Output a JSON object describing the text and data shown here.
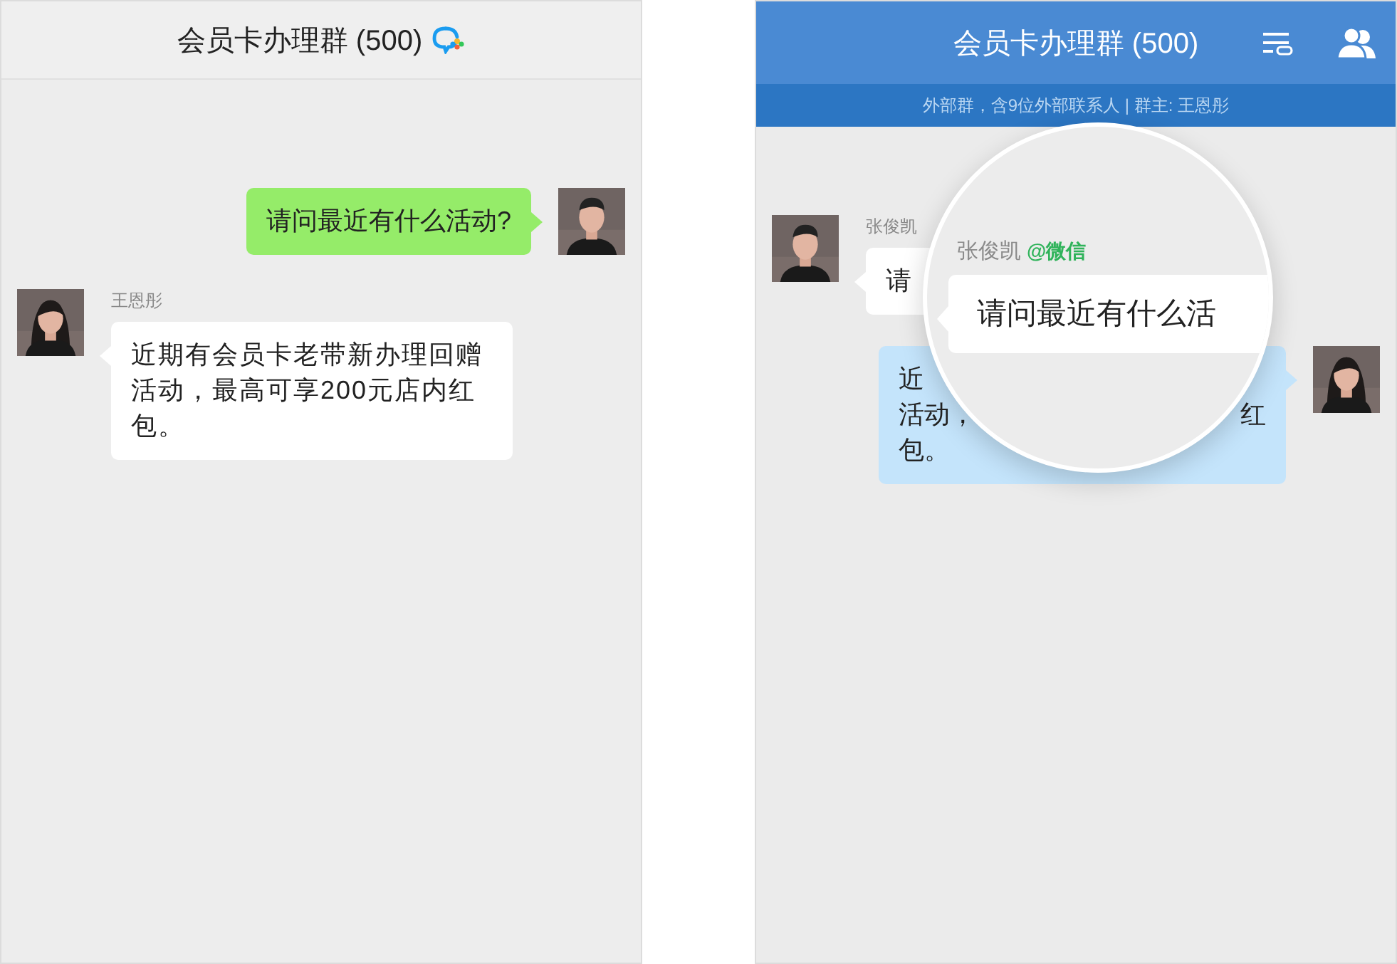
{
  "left_chat": {
    "title": "会员卡办理群 (500)",
    "messages": [
      {
        "kind": "outgoing",
        "text": "请问最近有什么活动?"
      },
      {
        "kind": "incoming",
        "sender": "王恩彤",
        "text": "近期有会员卡老带新办理回赠活动，最高可享200元店内红包。"
      }
    ]
  },
  "right_chat": {
    "title": "会员卡办理群 (500)",
    "subtitle": "外部群，含9位外部联系人 | 群主: 王恩彤",
    "messages": [
      {
        "kind": "incoming",
        "sender": "张俊凯",
        "lines": [
          [
            "请"
          ]
        ]
      },
      {
        "kind": "outgoing",
        "lines": [
          [
            "近"
          ],
          [
            "活动，",
            "红"
          ],
          [
            "包。"
          ]
        ]
      }
    ],
    "magnifier": {
      "sender": "张俊凯",
      "sender_tag": "@微信",
      "text": "请问最近有什么活"
    }
  }
}
